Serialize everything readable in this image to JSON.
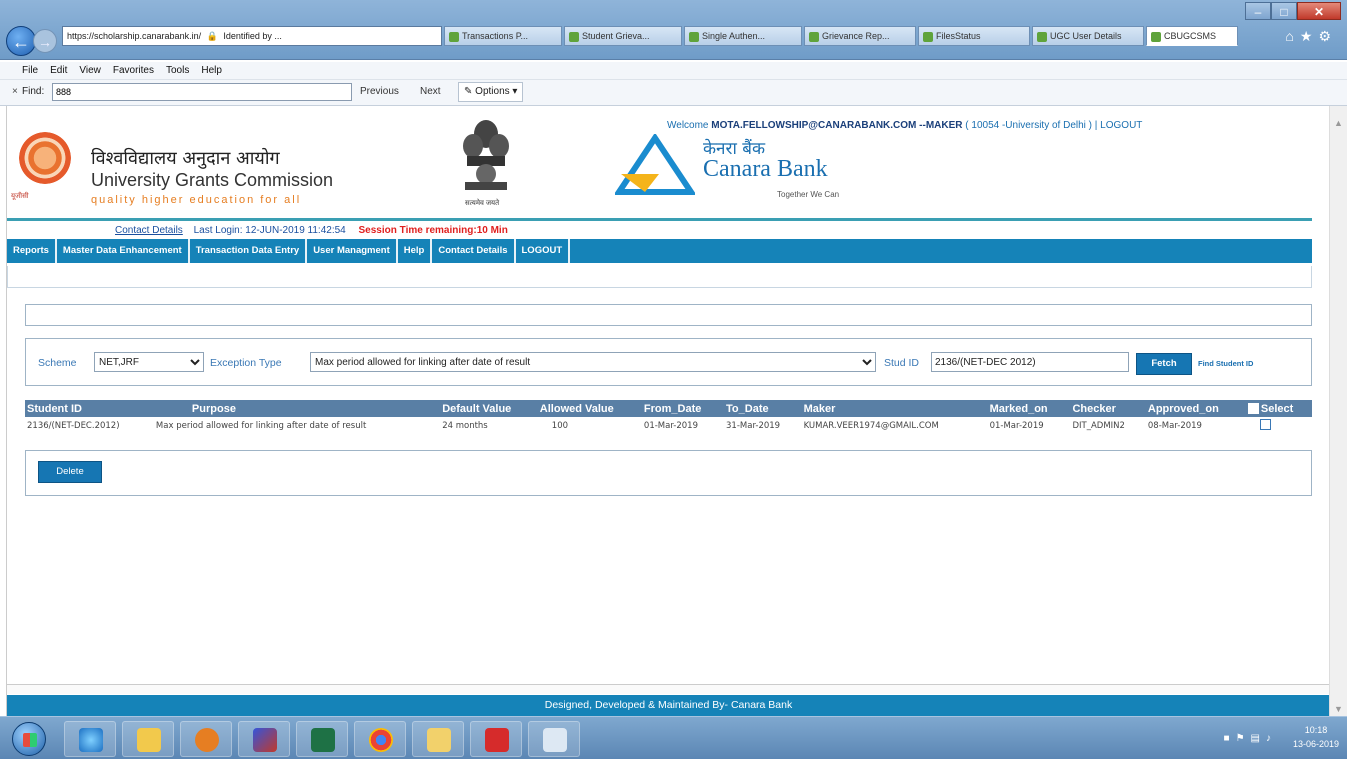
{
  "browser": {
    "address_url": "https://scholarship.canarabank.in/",
    "identified": "Identified by ...",
    "tabs": [
      "Transactions P...",
      "Student Grieva...",
      "Single Authen...",
      "Grievance Rep...",
      "FilesStatus",
      "UGC User Details",
      "CBUGCSMS"
    ],
    "menu": [
      "File",
      "Edit",
      "View",
      "Favorites",
      "Tools",
      "Help"
    ],
    "find_label": "Find:",
    "find_value": "888",
    "find_prev": "Previous",
    "find_next": "Next",
    "find_options": "Options"
  },
  "header": {
    "ugc_hindi": "विश्वविद्यालय अनुदान आयोग",
    "ugc_title": "University Grants Commission",
    "ugc_tagline": "quality higher education for all",
    "emblem_caption": "सत्यमेव जयते",
    "canara_hindi": "केनरा बैंक",
    "canara_name": "Canara Bank",
    "canara_tagline": "Together We Can",
    "welcome_prefix": "Welcome",
    "welcome_user": "MOTA.FELLOWSHIP@CANARABANK.COM",
    "welcome_role": "--MAKER",
    "welcome_org": "( 10054 -University of Delhi )",
    "welcome_sep": "|",
    "welcome_logout": "LOGOUT"
  },
  "infobar": {
    "contact": "Contact Details",
    "last_login": "Last Login: 12-JUN-2019 11:42:54",
    "session": "Session Time remaining:10 Min"
  },
  "nav": [
    "Reports",
    "Master Data Enhancement",
    "Transaction Data Entry",
    "User Managment",
    "Help",
    "Contact Details",
    "LOGOUT"
  ],
  "filter": {
    "scheme_label": "Scheme",
    "scheme_value": "NET,JRF",
    "exception_label": "Exception Type",
    "exception_value": "Max period allowed for linking after date of result",
    "stud_label": "Stud ID",
    "stud_value": "2136/(NET-DEC 2012)",
    "fetch_label": "Fetch",
    "find_student": "Find Student ID"
  },
  "table": {
    "headers": [
      "Student ID",
      "Purpose",
      "Default Value",
      "Allowed Value",
      "From_Date",
      "To_Date",
      "Maker",
      "Marked_on",
      "Checker",
      "Approved_on",
      "Select"
    ],
    "rows": [
      [
        "2136/(NET-DEC.2012)",
        "Max period allowed for linking after date of result",
        "24 months",
        "100",
        "01-Mar-2019",
        "31-Mar-2019",
        "KUMAR.VEER1974@GMAIL.COM",
        "01-Mar-2019",
        "DIT_ADMIN2",
        "08-Mar-2019"
      ]
    ]
  },
  "delete_label": "Delete",
  "footer": "Designed, Developed & Maintained By- Canara Bank",
  "taskbar": {
    "time": "10:18",
    "date": "13-06-2019"
  }
}
